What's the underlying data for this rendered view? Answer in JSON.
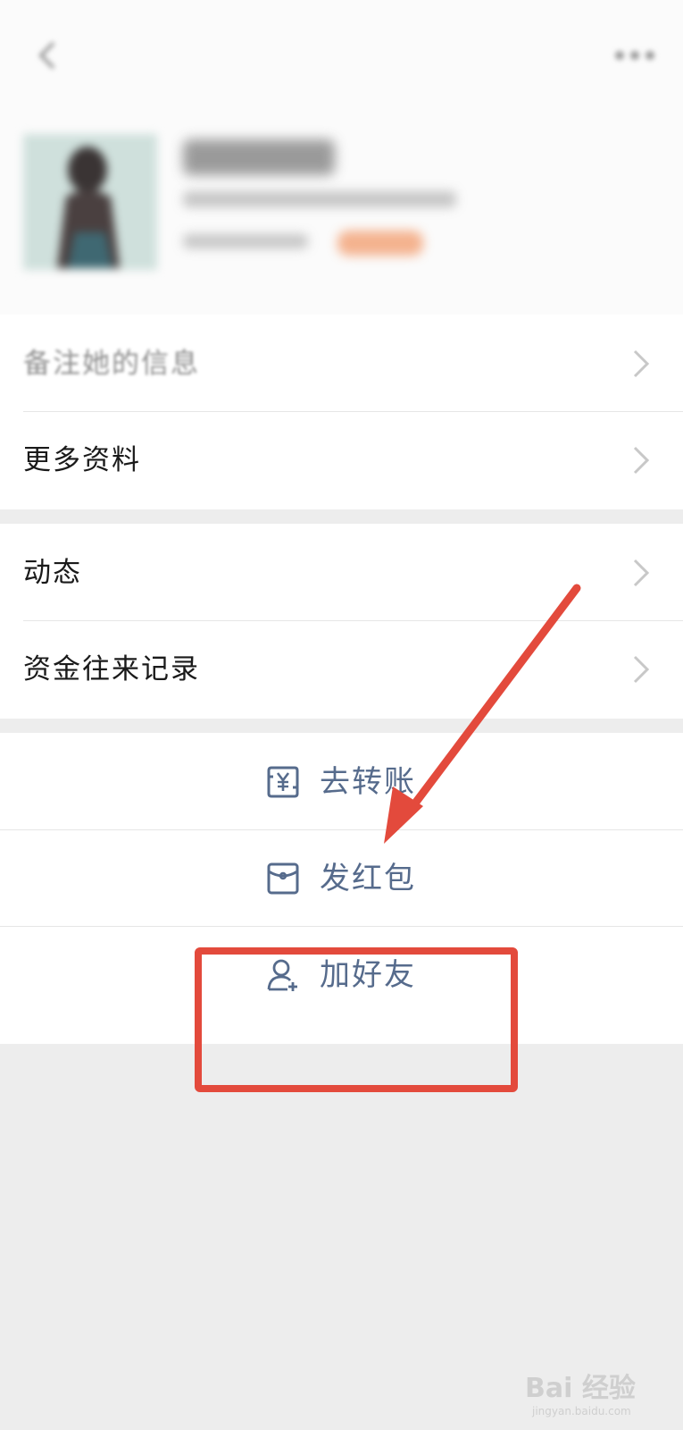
{
  "profile": {
    "remark_label": "备注她的信息",
    "more_info_label": "更多资料"
  },
  "section2": {
    "moments_label": "动态",
    "fund_records_label": "资金往来记录"
  },
  "actions": {
    "transfer_label": "去转账",
    "red_packet_label": "发红包",
    "add_friend_label": "加好友"
  },
  "colors": {
    "accent_text": "#566b8c",
    "highlight": "#e34a3c"
  },
  "watermark": {
    "brand": "Bai 经验",
    "url": "jingyan.baidu.com"
  }
}
